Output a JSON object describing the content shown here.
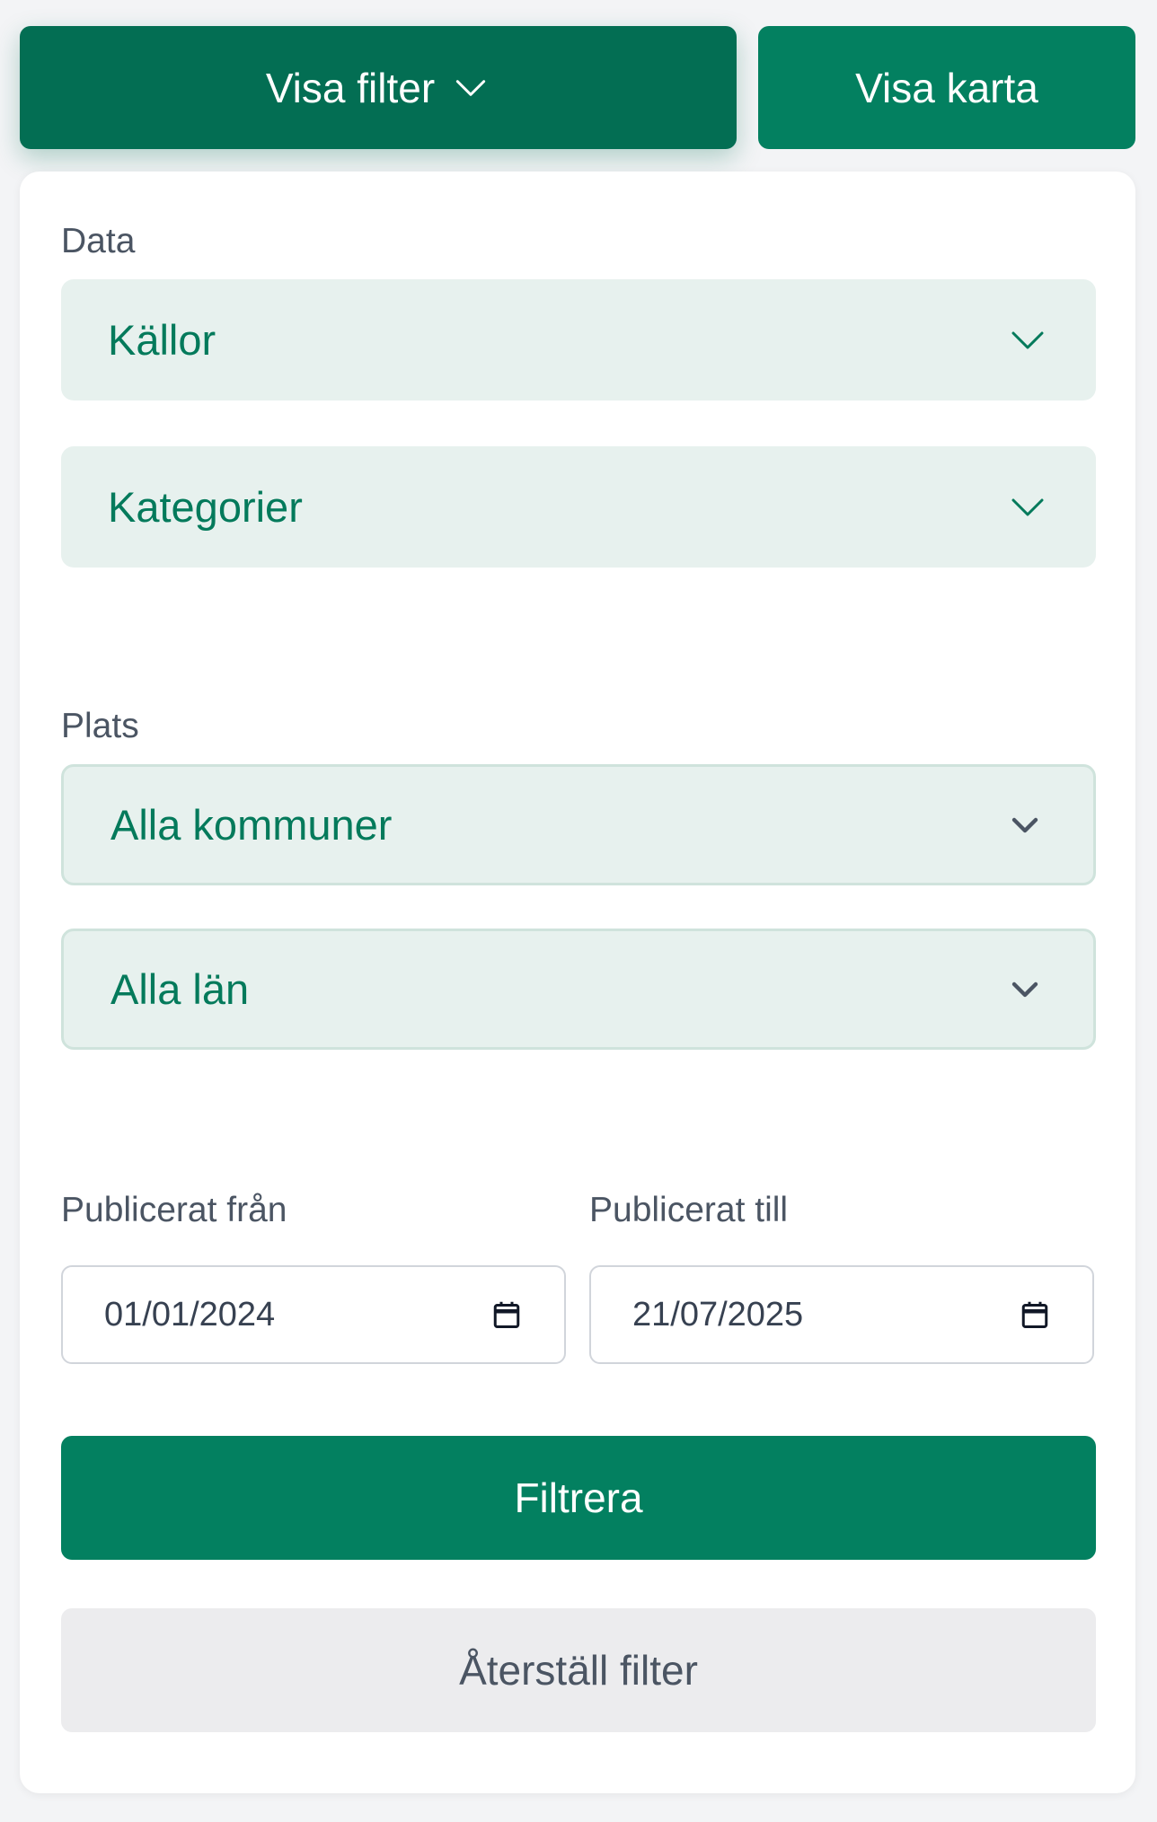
{
  "header": {
    "filter_button_label": "Visa filter",
    "map_button_label": "Visa karta"
  },
  "filters": {
    "data_section_label": "Data",
    "sources_select": "Källor",
    "categories_select": "Kategorier",
    "place_section_label": "Plats",
    "municipality_select": "Alla kommuner",
    "county_select": "Alla län",
    "published_from_label": "Publicerat från",
    "published_from_value": "01/01/2024",
    "published_to_label": "Publicerat till",
    "published_to_value": "21/07/2025",
    "apply_button_label": "Filtrera",
    "reset_button_label": "Återställ filter"
  },
  "colors": {
    "primary": "#038060",
    "primary_dark": "#036e53",
    "select_bg": "#e7f1ee",
    "select_text": "#047a5b"
  },
  "icons": {
    "filter_toggle": "chevron-down-icon",
    "select_arrow": "chevron-down-icon",
    "date_picker": "calendar-icon"
  }
}
